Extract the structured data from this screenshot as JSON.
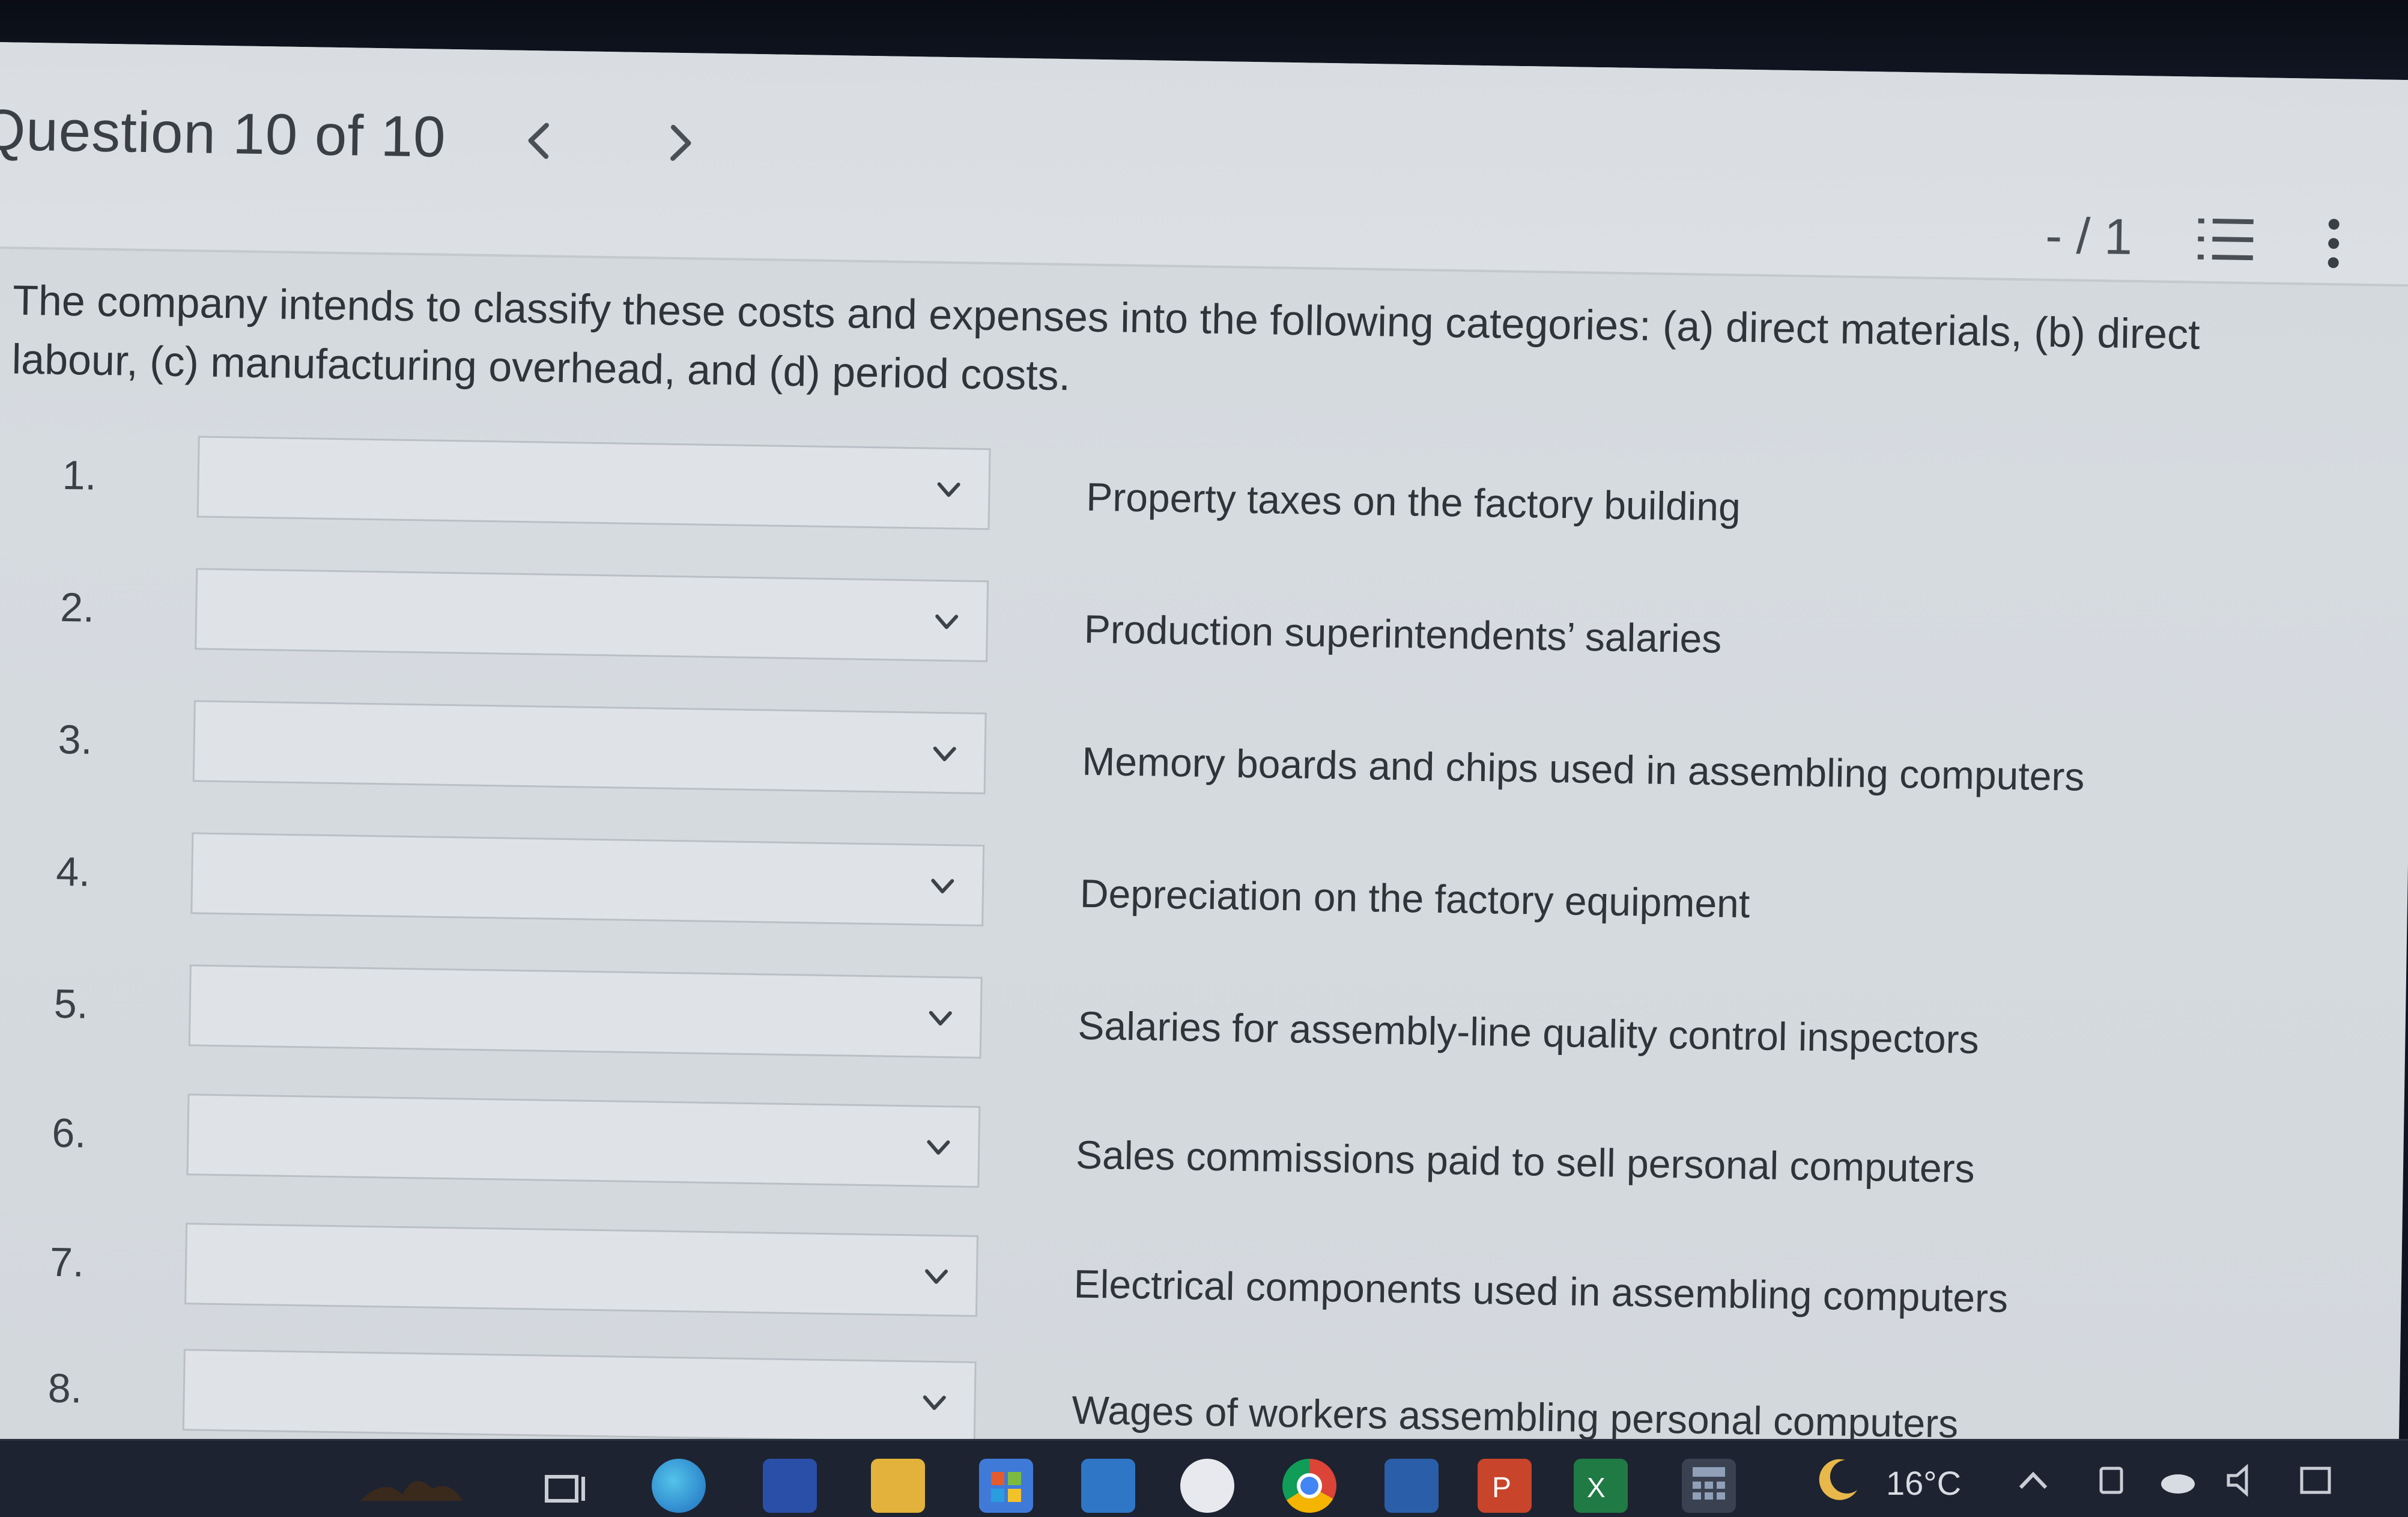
{
  "header": {
    "question_title": "Question 10 of 10",
    "score": "- / 1"
  },
  "instructions": "The company intends to classify these costs and expenses into the following categories: (a) direct materials, (b) direct labour, (c) manufacturing overhead, and (d) period costs.",
  "items": [
    {
      "number": "1.",
      "label": "Property taxes on the factory building",
      "selected": ""
    },
    {
      "number": "2.",
      "label": "Production superintendents’ salaries",
      "selected": ""
    },
    {
      "number": "3.",
      "label": "Memory boards and chips used in assembling computers",
      "selected": ""
    },
    {
      "number": "4.",
      "label": "Depreciation on the factory equipment",
      "selected": ""
    },
    {
      "number": "5.",
      "label": "Salaries for assembly-line quality control inspectors",
      "selected": ""
    },
    {
      "number": "6.",
      "label": "Sales commissions paid to sell personal computers",
      "selected": ""
    },
    {
      "number": "7.",
      "label": "Electrical components used in assembling computers",
      "selected": ""
    },
    {
      "number": "8.",
      "label": "Wages of workers assembling personal computers",
      "selected": ""
    }
  ],
  "taskbar": {
    "temperature": "16°C",
    "apps": [
      "task-view-icon",
      "edge-icon",
      "store-icon",
      "file-explorer-icon",
      "windows-store-icon",
      "mail-icon",
      "brave-icon",
      "chrome-icon",
      "photos-icon",
      "powerpoint-icon",
      "excel-icon",
      "calculator-icon"
    ],
    "colors": {
      "edge": "#1f9bd6",
      "excel": "#1f7a44",
      "powerpoint": "#c8442a",
      "chrome": "#e9b43a"
    }
  }
}
